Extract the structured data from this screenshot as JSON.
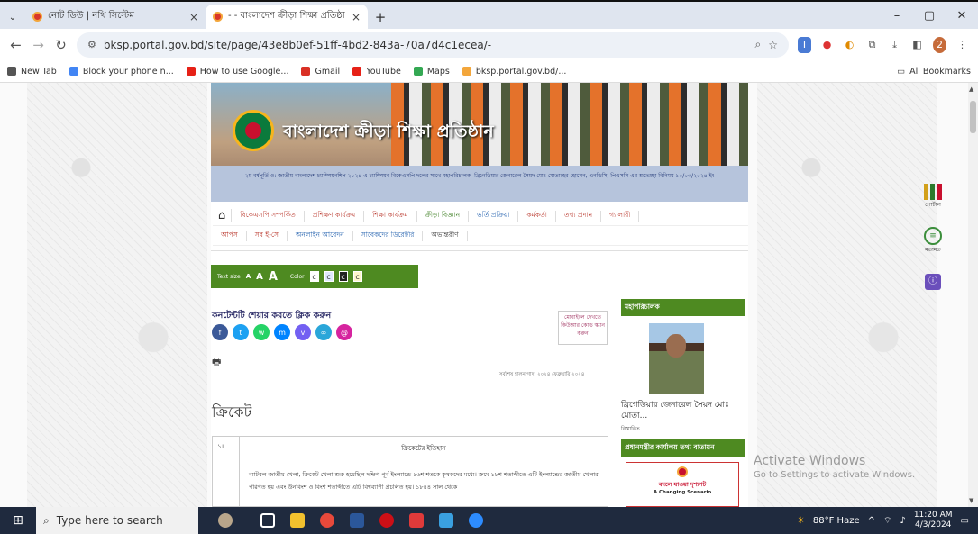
{
  "browser": {
    "tabs": [
      {
        "title": "নোট ডিউ | নথি সিস্টেম",
        "active": false
      },
      {
        "title": "- - বাংলাদেশ ক্রীড়া শিক্ষা প্রতিষ্ঠা",
        "active": true
      }
    ],
    "url": "bksp.portal.gov.bd/site/page/43e8b0ef-51ff-4bd2-843a-70a7d4c1ecea/-",
    "profile_initial": "2",
    "bookmarks": [
      {
        "label": "New Tab",
        "color": "#555555"
      },
      {
        "label": "Block your phone n...",
        "color": "#4285f4"
      },
      {
        "label": "How to use Google...",
        "color": "#e62117"
      },
      {
        "label": "Gmail",
        "color": "#d93025"
      },
      {
        "label": "YouTube",
        "color": "#e62117"
      },
      {
        "label": "Maps",
        "color": "#34a853"
      },
      {
        "label": "bksp.portal.gov.bd/...",
        "color": "#f3a63b"
      }
    ],
    "all_bookmarks": "All Bookmarks"
  },
  "site": {
    "name": "বাংলাদেশ ক্রীড়া শিক্ষা প্রতিষ্ঠান",
    "ticker": "২য় বর্ষপূর্তি ও: জাতীয় বাংলাদেশ চ্যাম্পিয়নশিপ ২০২৪ এ চ্যাম্পিয়ন বিকেএসপি দলের সাথে মহাপরিচালক- ব্রিগেডিয়ার জেনারেল সৈয়দ মোঃ মোতাহের হোসেন, এনডিসি, পিএসসি এর শুভেচ্ছা বিনিময় ১০/০৩/২০২৪ ইং",
    "menu_row1": [
      "বিকেএসপি সম্পর্কিত",
      "প্রশিক্ষণ কার্যক্রম",
      "শিক্ষা কার্যক্রম",
      "ক্রীড়া বিজ্ঞান",
      "ভর্তি প্রক্রিয়া",
      "কর্মকর্তা",
      "তথ্য প্রদান",
      "গ্যালারী"
    ],
    "menu_row2": [
      "আপস",
      "সব ই-সে",
      "অনলাইন আবেদন",
      "সাবেকদের ডিরেক্টরি",
      "অভ্যন্তরীণ"
    ],
    "text_size_label": "Text size",
    "text_size_options": [
      "A",
      "A",
      "A"
    ],
    "color_label": "Color",
    "color_options": [
      "c",
      "c",
      "c",
      "c"
    ],
    "share_title": "কনটেন্টটি শেয়ার করতে ক্লিক করুন",
    "share_buttons": [
      {
        "name": "facebook",
        "glyph": "f",
        "color": "#3b5998"
      },
      {
        "name": "twitter",
        "glyph": "t",
        "color": "#1da1f2"
      },
      {
        "name": "whatsapp",
        "glyph": "w",
        "color": "#25d366"
      },
      {
        "name": "messenger",
        "glyph": "m",
        "color": "#0084ff"
      },
      {
        "name": "viber",
        "glyph": "v",
        "color": "#7360f2"
      },
      {
        "name": "copy-link",
        "glyph": "∞",
        "color": "#2aa6d9"
      },
      {
        "name": "email",
        "glyph": "@",
        "color": "#d6249f"
      }
    ],
    "qr_text": "মোবাইলে দেখতে কিউআর কোড স্ক্যান করুন",
    "updated": "সর্বশেষ হালনাগাদ: ২০২৪ ফেব্রুয়ারি ২০২৪",
    "content_title": "ক্রিকেট",
    "table": {
      "num": "১।",
      "heading": "ক্রিকেটের ইতিহাস",
      "body": "ব্যাটবল জাতীয় খেলা, ক্রিকেট খেলা শুরু হয়েছিল দক্ষিণ-পূর্ব ইংল্যান্ডে ১৬শ শতকে কৃষকদের মধ্যে। ক্রমে ১৮শ শতাব্দীতে এটি ইংল্যান্ডের জাতীয় খেলার পরিণত হয় এবং উনবিংশ ও বিংশ শতাব্দীতে এটি বিশ্বব্যাপী প্রচলিত হয়। ১৮৪৪ সাল থেকে"
    },
    "sidebar": {
      "dg_heading": "মহাপরিচালক",
      "dg_name": "ব্রিগেডিয়ার জেনারেল সৈয়দ মোঃ মোতা...",
      "dg_link": "বিস্তারিত",
      "hotline_heading": "প্রধানমন্ত্রীর কার্যালয় তথ্য বাতায়ন",
      "hotline_title": "বদলে যাওয়া দৃশ্যপট",
      "hotline_sub": "A Changing Scenario"
    },
    "right_widgets": {
      "chart_label": "পোর্টাল",
      "chat_label": "মতামত"
    }
  },
  "windows_notice": {
    "line1": "Activate Windows",
    "line2": "Go to Settings to activate Windows."
  },
  "taskbar": {
    "search_placeholder": "Type here to search",
    "weather": "88°F Haze",
    "time": "11:20 AM",
    "date": "4/3/2024"
  }
}
